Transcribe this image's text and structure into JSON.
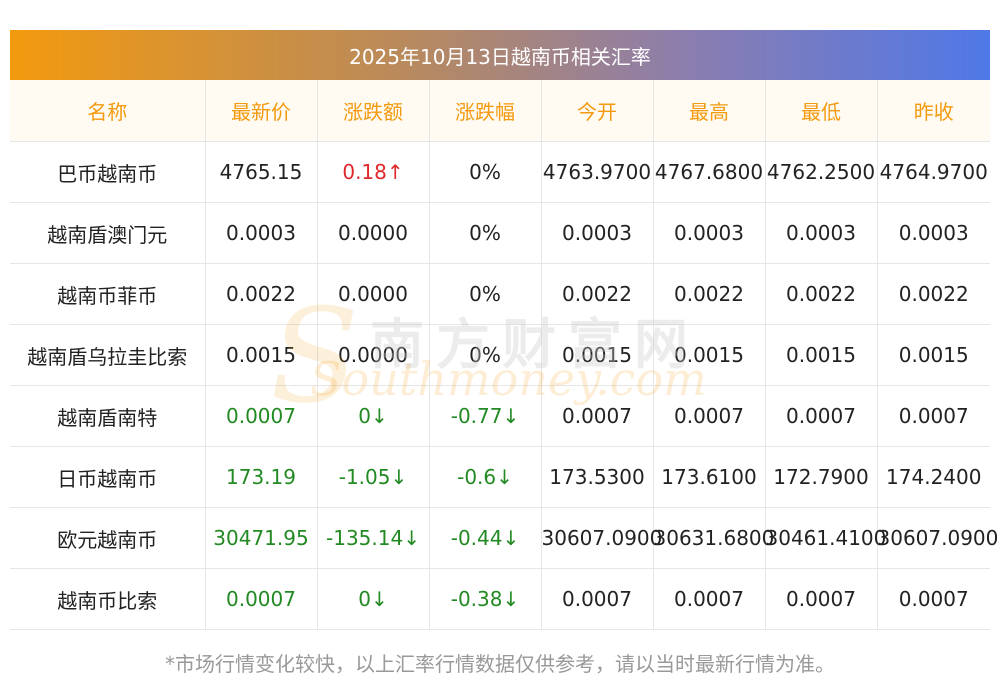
{
  "title": "2025年10月13日越南币相关汇率",
  "headers": [
    "名称",
    "最新价",
    "涨跌额",
    "涨跌幅",
    "今开",
    "最高",
    "最低",
    "昨收"
  ],
  "rows": [
    {
      "name": "巴币越南币",
      "latest": "4765.15",
      "change": "0.18↑",
      "pct": "0%",
      "open": "4763.9700",
      "high": "4767.6800",
      "low": "4762.2500",
      "prev": "4764.9700",
      "latest_trend": "none",
      "change_trend": "up",
      "pct_trend": "none"
    },
    {
      "name": "越南盾澳门元",
      "latest": "0.0003",
      "change": "0.0000",
      "pct": "0%",
      "open": "0.0003",
      "high": "0.0003",
      "low": "0.0003",
      "prev": "0.0003",
      "latest_trend": "none",
      "change_trend": "none",
      "pct_trend": "none"
    },
    {
      "name": "越南币菲币",
      "latest": "0.0022",
      "change": "0.0000",
      "pct": "0%",
      "open": "0.0022",
      "high": "0.0022",
      "low": "0.0022",
      "prev": "0.0022",
      "latest_trend": "none",
      "change_trend": "none",
      "pct_trend": "none"
    },
    {
      "name": "越南盾乌拉圭比索",
      "latest": "0.0015",
      "change": "0.0000",
      "pct": "0%",
      "open": "0.0015",
      "high": "0.0015",
      "low": "0.0015",
      "prev": "0.0015",
      "latest_trend": "none",
      "change_trend": "none",
      "pct_trend": "none"
    },
    {
      "name": "越南盾南特",
      "latest": "0.0007",
      "change": "0↓",
      "pct": "-0.77↓",
      "open": "0.0007",
      "high": "0.0007",
      "low": "0.0007",
      "prev": "0.0007",
      "latest_trend": "down",
      "change_trend": "down",
      "pct_trend": "down"
    },
    {
      "name": "日币越南币",
      "latest": "173.19",
      "change": "-1.05↓",
      "pct": "-0.6↓",
      "open": "173.5300",
      "high": "173.6100",
      "low": "172.7900",
      "prev": "174.2400",
      "latest_trend": "down",
      "change_trend": "down",
      "pct_trend": "down"
    },
    {
      "name": "欧元越南币",
      "latest": "30471.95",
      "change": "-135.14↓",
      "pct": "-0.44↓",
      "open": "30607.0900",
      "high": "30631.6800",
      "low": "30461.4100",
      "prev": "30607.0900",
      "latest_trend": "down",
      "change_trend": "down",
      "pct_trend": "down"
    },
    {
      "name": "越南币比索",
      "latest": "0.0007",
      "change": "0↓",
      "pct": "-0.38↓",
      "open": "0.0007",
      "high": "0.0007",
      "low": "0.0007",
      "prev": "0.0007",
      "latest_trend": "down",
      "change_trend": "down",
      "pct_trend": "down"
    }
  ],
  "footnote": "*市场行情变化较快，以上汇率行情数据仅供参考，请以当时最新行情为准。",
  "watermark": {
    "cn": "南方财富网",
    "en": "Southmoney.com"
  },
  "colors": {
    "accent": "#f39a0e",
    "up": "#e0282b",
    "down": "#238a23"
  }
}
